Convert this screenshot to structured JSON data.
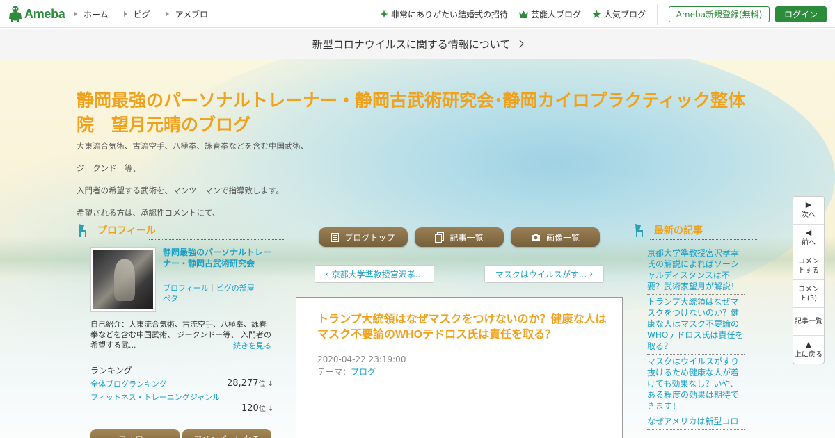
{
  "topbar": {
    "brand": "Ameba",
    "nav": [
      "ホーム",
      "ピグ",
      "アメブロ"
    ],
    "links": [
      {
        "label": "非常にありがたい結婚式の招待",
        "icon": "sparkle-icon"
      },
      {
        "label": "芸能人ブログ",
        "icon": "crown-icon"
      },
      {
        "label": "人気ブログ",
        "icon": "star-icon"
      }
    ],
    "register_label": "Ameba新規登録(無料)",
    "login_label": "ログイン"
  },
  "notice": {
    "text": "新型コロナウイルスに関する情報について"
  },
  "header": {
    "title": "静岡最強のパーソナルトレーナー・静岡古武術研究会･静岡カイロプラクティック整体院　望月元晴のブログ",
    "description": [
      "大東流合気術、古流空手、八極拳、詠春拳などを含む中国武術、",
      "ジークンドー等、",
      "入門者の希望する武術を、マンツーマンで指導致します。",
      "希望される方は、承認性コメントにて、"
    ]
  },
  "profile": {
    "heading": "プロフィール",
    "name": "静岡最強のパーソナルトレーナー・静岡古武術研究会",
    "links": [
      "プロフィール",
      "ピグの部屋",
      "ペタ"
    ],
    "intro": "自己紹介：大東流合気術、古流空手、八極拳、詠春拳などを含む中国武術、 ジークンドー等、 入門者の希望する武...",
    "more": "続きを見る",
    "ranking": {
      "title": "ランキング",
      "rows": [
        {
          "label": "全体ブログランキング",
          "value": "28,277",
          "unit": "位 ↓"
        },
        {
          "label": "フィットネス・トレーニングジャンル",
          "value": "120",
          "unit": "位 ↓"
        }
      ]
    },
    "buttons": [
      "フォロー",
      "アメンバーになる"
    ]
  },
  "center": {
    "tabs": [
      "ブログトップ",
      "記事一覧",
      "画像一覧"
    ],
    "prev_article": "京都大学準教授宮沢孝...",
    "next_article": "マスクはウイルスがす...",
    "article": {
      "title": "トランプ大統領はなぜマスクをつけないのか？健康な人はマスク不要論のWHOテドロス氏は責任を取る？",
      "date": "2020-04-22 23:19:00",
      "theme_label": "テーマ：",
      "theme": "ブログ"
    }
  },
  "recent": {
    "heading": "最新の記事",
    "items": [
      "京都大学準教授宮沢孝幸氏の解説によればソーシャルディスタンスは不要？武術家望月が解説！",
      "トランプ大統領はなぜマスクをつけないのか？健康な人はマスク不要論のWHOテドロス氏は責任を取る？",
      "マスクはウイルスがすり抜けるため健康な人が着けても効果なし？いや、ある程度の効果は期待できます！",
      "なぜアメリカは新型コロ"
    ]
  },
  "floatnav": [
    {
      "label": "次へ",
      "icon": "▶"
    },
    {
      "label": "前へ",
      "icon": "◀"
    },
    {
      "label": "コメントする",
      "icon": ""
    },
    {
      "label": "コメント(3)",
      "icon": ""
    },
    {
      "label": "記事一覧",
      "icon": ""
    },
    {
      "label": "上に戻る",
      "icon": "▲"
    }
  ],
  "colors": {
    "brand_green": "#2d8c3c",
    "title_orange": "#f1a21c",
    "link_blue": "#1aa0c8",
    "tab_brown": "#8a6f45"
  }
}
